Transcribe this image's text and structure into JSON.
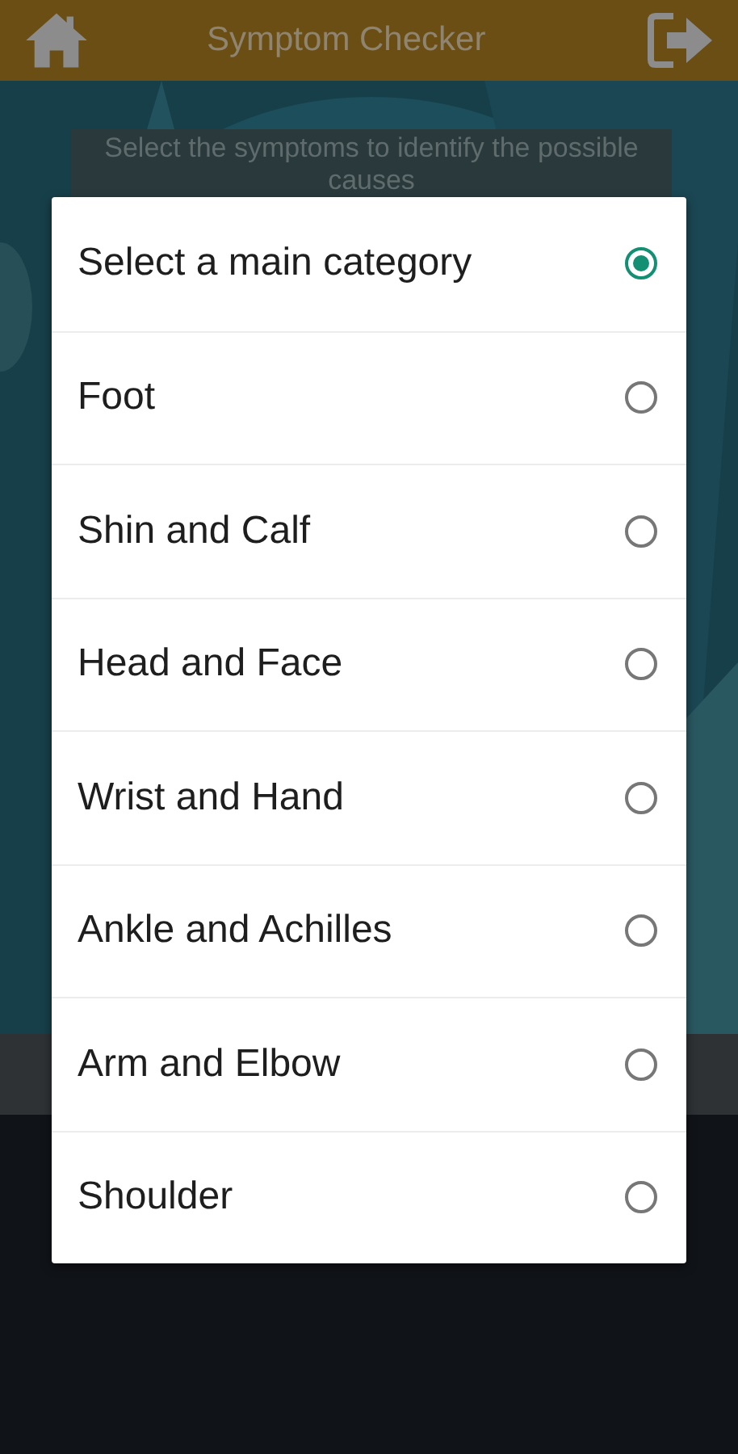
{
  "header": {
    "title": "Symptom Checker"
  },
  "banner": {
    "text": "Select the symptoms to identify the possible causes"
  },
  "dialog": {
    "options": [
      {
        "label": "Select a main category",
        "selected": true
      },
      {
        "label": "Foot",
        "selected": false
      },
      {
        "label": "Shin and Calf",
        "selected": false
      },
      {
        "label": "Head and Face",
        "selected": false
      },
      {
        "label": "Wrist and Hand",
        "selected": false
      },
      {
        "label": "Ankle and Achilles",
        "selected": false
      },
      {
        "label": "Arm and Elbow",
        "selected": false
      },
      {
        "label": "Shoulder",
        "selected": false
      }
    ]
  }
}
